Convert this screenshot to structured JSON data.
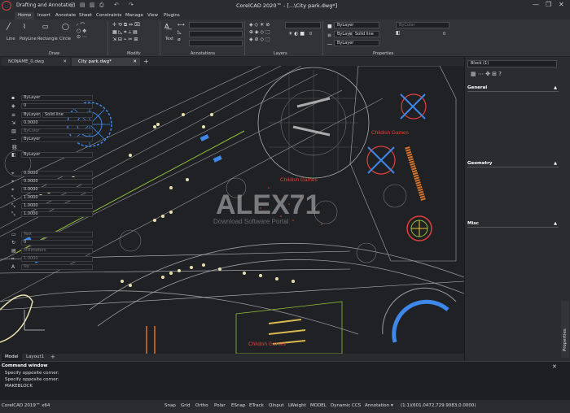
{
  "titlebar": {
    "workspace": "Drafting and Annotation",
    "title": "CorelCAD 2020™ - [...\\City park.dwg*]",
    "quick_access": [
      "▢",
      "▤",
      "▥",
      "⎙",
      "↶",
      "↷"
    ],
    "window_buttons": [
      "—",
      "❐",
      "✕"
    ]
  },
  "menu": [
    "Home",
    "Insert",
    "Annotate",
    "Sheet",
    "Constraints",
    "Manage",
    "View",
    "Plugins"
  ],
  "ribbon": {
    "draw_tools": [
      "Line",
      "PolyLine",
      "Rectangle",
      "Circle"
    ],
    "draw_group": "Draw",
    "modify_group": "Modify",
    "annotations_group": "Annotations",
    "text_label": "Text",
    "layers_group": "Layers",
    "properties_group": "Properties",
    "layer_value": "0",
    "prop_bylayer_1": "ByLayer",
    "prop_bylayer_2": "ByLayer",
    "prop_solid_line": "Solid line",
    "prop_bylayer_3": "ByLayer",
    "prop_bycolor": "ByColor",
    "prop_zero": "0"
  },
  "doc_tabs": [
    "NONAME_0.dwg",
    "City park.dwg*"
  ],
  "layout_tabs": [
    "Model",
    "Layout1"
  ],
  "canvas": {
    "labels": [
      "Childish Games",
      "Childish Games",
      "Childish Games"
    ],
    "watermark": "ALEX71",
    "watermark_sub": "Download Software Portal"
  },
  "props": {
    "selection": "Block (1)",
    "general_title": "General",
    "general": [
      "ByLayer",
      "0",
      "ByLayer",
      "0.0000",
      "ByColor",
      "ByLayer",
      "ByLayer"
    ],
    "general_line": "Solid line",
    "geometry_title": "Geometry",
    "geometry": [
      "0.0000",
      "0.0000",
      "0.0000",
      "1.0000",
      "1.0000",
      "1.0000"
    ],
    "misc_title": "Misc",
    "misc": [
      "Text",
      "0",
      "Millimeters",
      "1.0000",
      "No"
    ],
    "vertical_tab": "Properties"
  },
  "cmd": {
    "title": "Command window",
    "lines": [
      "Specify opposite corner:",
      "Specify opposite corner:",
      "MAKEBLOCK"
    ]
  },
  "status": {
    "app": "CorelCAD 2019™ x64",
    "toggles": [
      "Snap",
      "Grid",
      "Ortho",
      "Polar",
      "ESnap",
      "ETrack",
      "QInput",
      "LWeight",
      "MODEL",
      "Dynamic CCS"
    ],
    "annotation": "Annotation",
    "scale": "(1:1)",
    "coords": "(601.0472,729.9083,0.0000)"
  },
  "colors": {
    "accent_red": "#e0403c",
    "accent_blue": "#3d88e8",
    "accent_orange": "#d9752a",
    "canvas_bg": "#202124"
  }
}
